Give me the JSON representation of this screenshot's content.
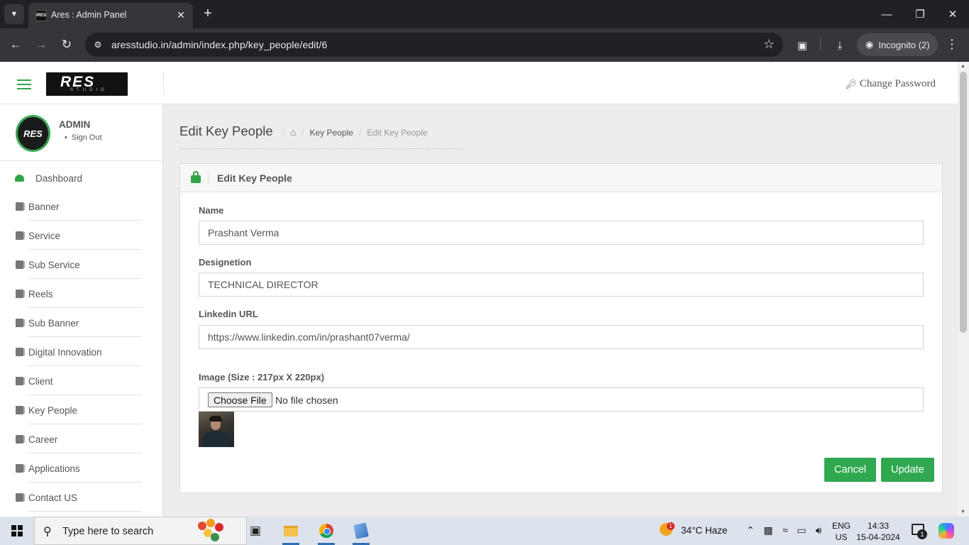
{
  "browser": {
    "tab_title": "Ares : Admin Panel",
    "tab_favicon_text": "/RES",
    "url": "aresstudio.in/admin/index.php/key_people/edit/6",
    "incognito_label": "Incognito (2)"
  },
  "app": {
    "logo_text": "RES",
    "logo_sub": "STUDIO",
    "change_password": "Change Password",
    "user_name": "ADMIN",
    "sign_out": "Sign Out",
    "avatar_text": "RES",
    "accent_color": "#33a34a"
  },
  "sidebar": {
    "items": [
      {
        "label": "Dashboard",
        "icon": "dashboard-icon"
      },
      {
        "label": "Banner",
        "icon": "book-icon"
      },
      {
        "label": "Service",
        "icon": "book-icon"
      },
      {
        "label": "Sub Service",
        "icon": "book-icon"
      },
      {
        "label": "Reels",
        "icon": "book-icon"
      },
      {
        "label": "Sub Banner",
        "icon": "book-icon"
      },
      {
        "label": "Digital Innovation",
        "icon": "book-icon"
      },
      {
        "label": "Client",
        "icon": "book-icon"
      },
      {
        "label": "Key People",
        "icon": "book-icon"
      },
      {
        "label": "Career",
        "icon": "book-icon"
      },
      {
        "label": "Applications",
        "icon": "book-icon"
      },
      {
        "label": "Contact US",
        "icon": "book-icon"
      }
    ]
  },
  "header": {
    "title": "Edit Key People",
    "breadcrumb": [
      "Key People",
      "Edit Key People"
    ]
  },
  "form": {
    "box_title": "Edit Key People",
    "name_label": "Name",
    "name_value": "Prashant Verma",
    "designation_label": "Designetion",
    "designation_value": "TECHNICAL DIRECTOR",
    "linkedin_label": "Linkedin URL",
    "linkedin_value": "https://www.linkedin.com/in/prashant07verma/",
    "image_label": "Image (Size : 217px X 220px)",
    "choose_file": "Choose File",
    "no_file": "No file chosen",
    "cancel": "Cancel",
    "update": "Update"
  },
  "taskbar": {
    "search_placeholder": "Type here to search",
    "weather": "34°C  Haze",
    "weather_badge": "1",
    "lang_top": "ENG",
    "lang_bottom": "US",
    "time": "14:33",
    "date": "15-04-2024",
    "notif_count": "1"
  }
}
